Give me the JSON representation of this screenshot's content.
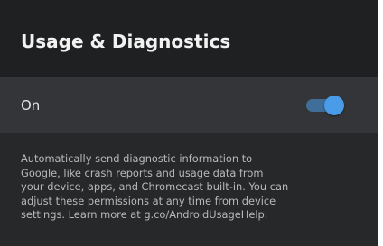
{
  "page": {
    "title": "Usage & Diagnostics"
  },
  "setting": {
    "label": "On",
    "toggle_on": true,
    "accent_color": "#4a9be8"
  },
  "description": {
    "lines": [
      "Automatically send diagnostic information to",
      "Google, like crash reports and usage data from",
      "your device, apps, and Chromecast built-in. You can",
      "adjust these permissions at any time from device",
      "settings. Learn more at g.co/AndroidUsageHelp."
    ]
  }
}
